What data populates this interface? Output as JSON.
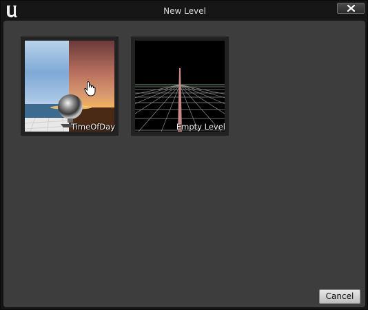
{
  "window": {
    "title": "New Level",
    "logo_icon": "unreal-logo-icon",
    "close_icon": "close-x-icon"
  },
  "templates": [
    {
      "label": "TimeOfDay",
      "thumbnail": "time-of-day-sphere-thumbnail"
    },
    {
      "label": "Empty Level",
      "thumbnail": "empty-grid-thumbnail"
    }
  ],
  "footer": {
    "cancel_label": "Cancel"
  },
  "colors": {
    "panel": "#3d3d3d",
    "titlebar": "#161616",
    "tile_frame": "#222222",
    "grid_line": "#c8c8c8",
    "horizon_green": "#6f9f6f",
    "center_line": "#c98a8a"
  }
}
